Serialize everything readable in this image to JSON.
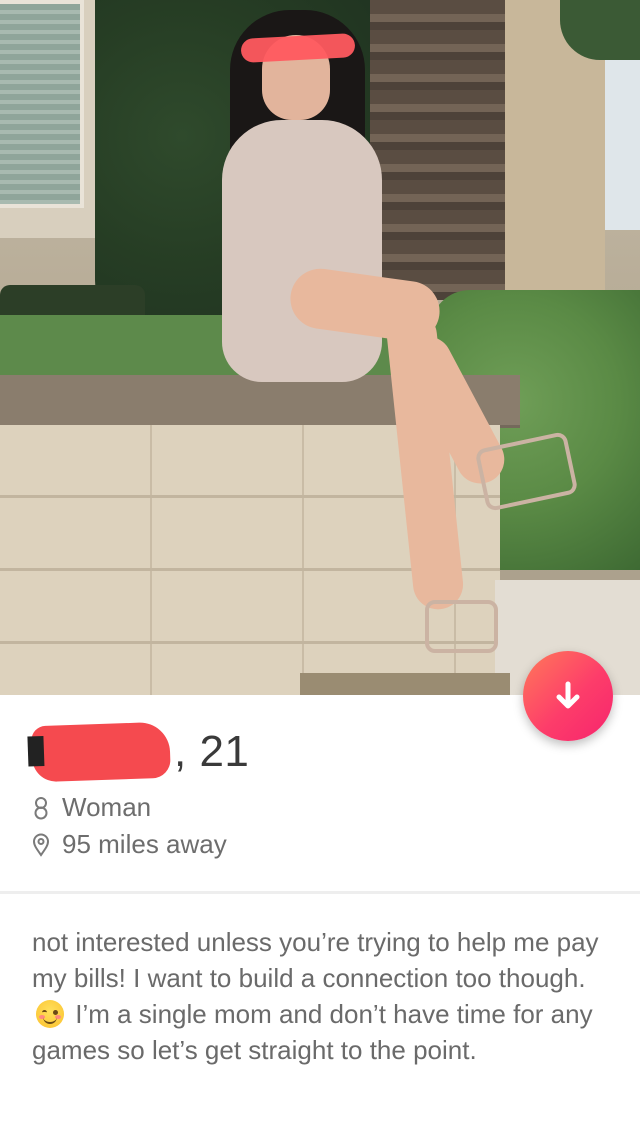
{
  "profile": {
    "age_text": ", 21",
    "gender": "Woman",
    "distance": "95 miles away"
  },
  "bio": {
    "part1": "not interested unless you’re trying to help me pay my bills! I want to build a connection too though. ",
    "emoji": "blush-emoji",
    "part2": " I’m a single mom and don’t have time for any games so let’s get straight to the point."
  },
  "icons": {
    "fab": "arrow-down-icon",
    "gender": "person-icon",
    "distance": "location-pin-icon"
  },
  "colors": {
    "accent": "#fd3d6a",
    "redaction": "#ff5a5f",
    "text": "#6a6a6a"
  }
}
